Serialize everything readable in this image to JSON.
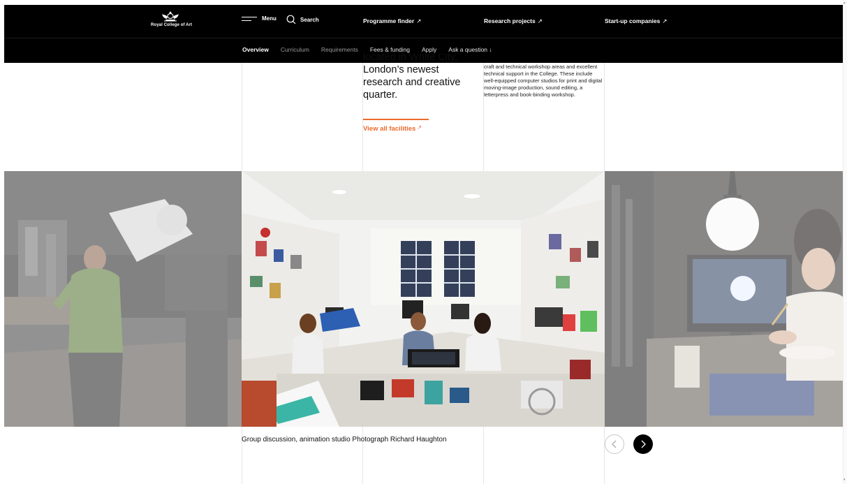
{
  "header": {
    "logo_text": "Royal College of Art",
    "menu_label": "Menu",
    "search_label": "Search",
    "top_links": [
      {
        "label": "Programme finder",
        "arrow": "↗"
      },
      {
        "label": "Research projects",
        "arrow": "↗"
      },
      {
        "label": "Start-up companies",
        "arrow": "↗"
      }
    ]
  },
  "subnav": {
    "items": [
      {
        "label": "Overview",
        "state": "active"
      },
      {
        "label": "Curriculum",
        "state": "inactive"
      },
      {
        "label": "Requirements",
        "state": "inactive"
      },
      {
        "label": "Fees & funding",
        "state": "light"
      },
      {
        "label": "Apply",
        "state": "light"
      },
      {
        "label": "Ask a question ↓",
        "state": "light"
      }
    ]
  },
  "content": {
    "lead_text_cut": "located in White City,",
    "lead_text": "London’s newest research and creative quarter.",
    "side_text": "craft and technical workshop areas and excellent technical support in the College. These include well-equipped computer studios for print and digital moving-image production, sound editing, a letterpress and book-binding workshop.",
    "facilities_link": "View all facilities",
    "facilities_arrow": "↗"
  },
  "carousel": {
    "caption": "Group discussion, animation studio Photograph Richard Haughton",
    "prev_icon": "chevron-left-icon",
    "next_icon": "chevron-right-icon"
  },
  "colors": {
    "accent": "#ec6a2c",
    "header_bg": "#000000"
  }
}
